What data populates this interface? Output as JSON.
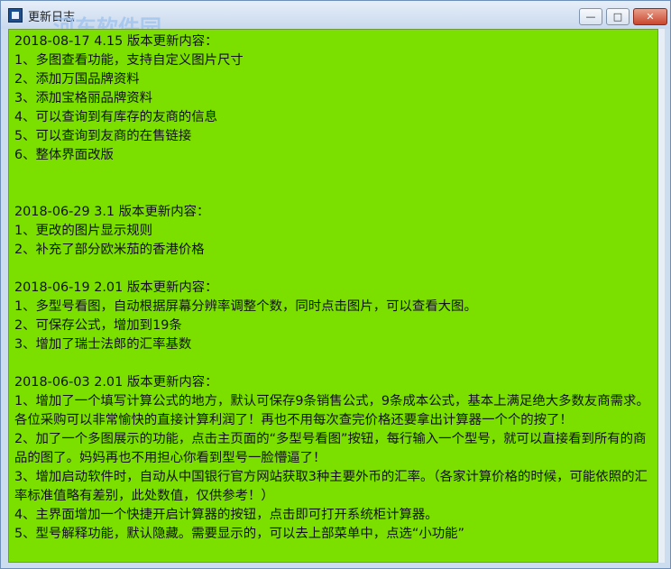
{
  "window": {
    "title": "更新日志",
    "watermark": "河东软件园",
    "controls": {
      "minimize": "—",
      "maximize": "□",
      "close": "✕"
    }
  },
  "content": {
    "lines": [
      "2018-08-17 4.15 版本更新内容：",
      "1、多图查看功能，支持自定义图片尺寸",
      "2、添加万国品牌资料",
      "3、添加宝格丽品牌资料",
      "4、可以查询到有库存的友商的信息",
      "5、可以查询到友商的在售链接",
      "6、整体界面改版",
      "",
      "",
      "2018-06-29 3.1 版本更新内容：",
      "1、更改的图片显示规则",
      "2、补充了部分欧米茄的香港价格",
      "",
      "2018-06-19 2.01 版本更新内容：",
      "1、多型号看图，自动根据屏幕分辨率调整个数，同时点击图片，可以查看大图。",
      "2、可保存公式，增加到19条",
      "3、增加了瑞士法郎的汇率基数",
      "",
      "2018-06-03 2.01 版本更新内容：",
      "1、增加了一个填写计算公式的地方，默认可保存9条销售公式，9条成本公式，基本上满足绝大多数友商需求。各位采购可以非常愉快的直接计算利润了！再也不用每次查完价格还要拿出计算器一个个的按了！",
      "2、加了一个多图展示的功能，点击主页面的“多型号看图”按钮，每行输入一个型号，就可以直接看到所有的商品的图了。妈妈再也不用担心你看到型号一脸懵逼了！",
      "3、增加启动软件时，自动从中国银行官方网站获取3种主要外币的汇率。（各家计算价格的时候，可能依照的汇率标准值略有差别，此处数值，仅供参考！）",
      "4、主界面增加一个快捷开启计算器的按钮，点击即可打开系统柜计算器。",
      "5、型号解释功能，默认隐藏。需要显示的，可以去上部菜单中，点选“小功能”"
    ]
  }
}
